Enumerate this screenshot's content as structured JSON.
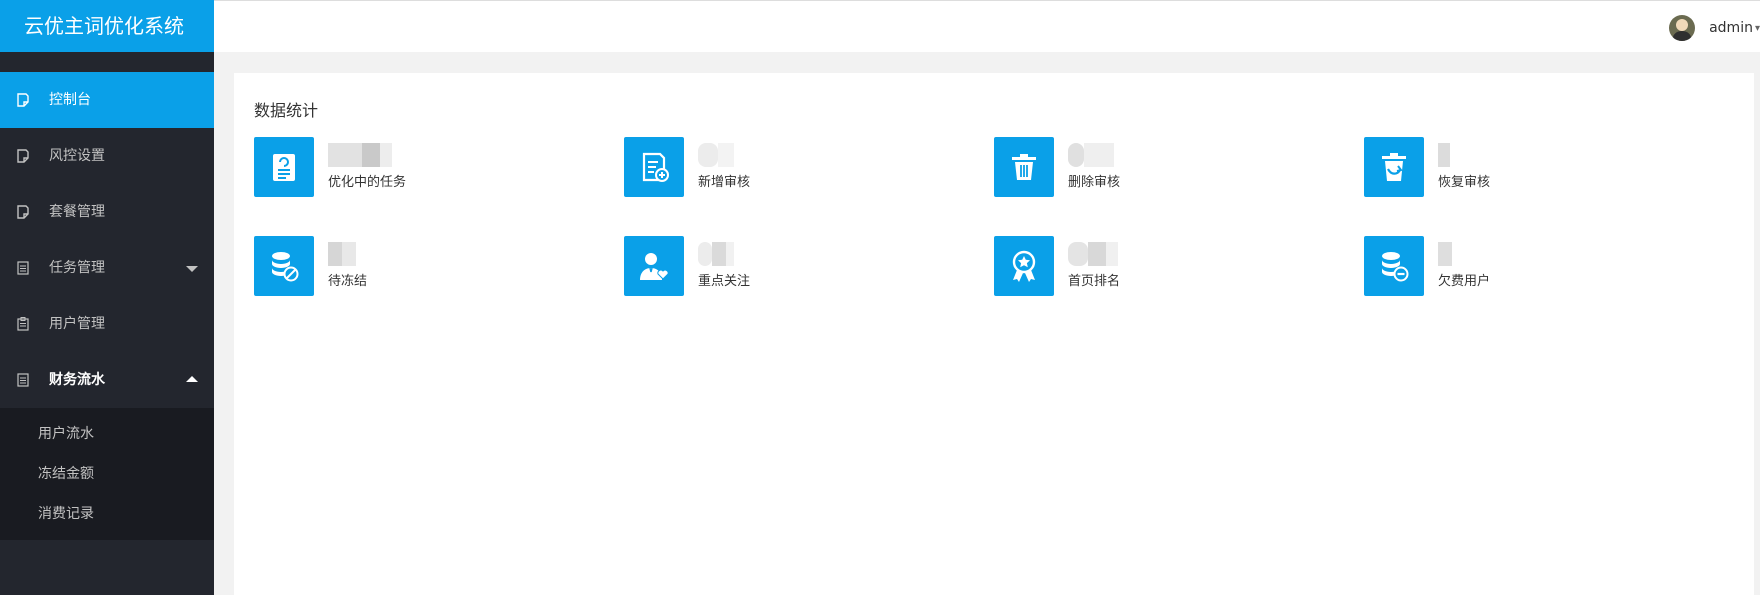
{
  "app": {
    "title": "云优主词优化系统"
  },
  "header": {
    "username": "admin",
    "caret": "▾"
  },
  "sidebar": {
    "items": [
      {
        "label": "控制台"
      },
      {
        "label": "风控设置"
      },
      {
        "label": "套餐管理"
      },
      {
        "label": "任务管理"
      },
      {
        "label": "用户管理"
      },
      {
        "label": "财务流水"
      }
    ],
    "sub_items": [
      {
        "label": "用户流水"
      },
      {
        "label": "冻结金额"
      },
      {
        "label": "消费记录"
      }
    ]
  },
  "main": {
    "section_title": "数据统计",
    "stats": [
      {
        "label": "优化中的任务",
        "icon": "task-list-icon"
      },
      {
        "label": "新增审核",
        "icon": "document-add-icon"
      },
      {
        "label": "删除审核",
        "icon": "trash-icon"
      },
      {
        "label": "恢复审核",
        "icon": "recycle-bin-icon"
      },
      {
        "label": "待冻结",
        "icon": "coin-stack-blocked-icon"
      },
      {
        "label": "重点关注",
        "icon": "user-heart-icon"
      },
      {
        "label": "首页排名",
        "icon": "award-badge-icon"
      },
      {
        "label": "欠费用户",
        "icon": "coin-stack-minus-icon"
      }
    ]
  },
  "colors": {
    "accent": "#0aa0e8",
    "sidebar": "#23262e",
    "subnav": "#191b21"
  }
}
